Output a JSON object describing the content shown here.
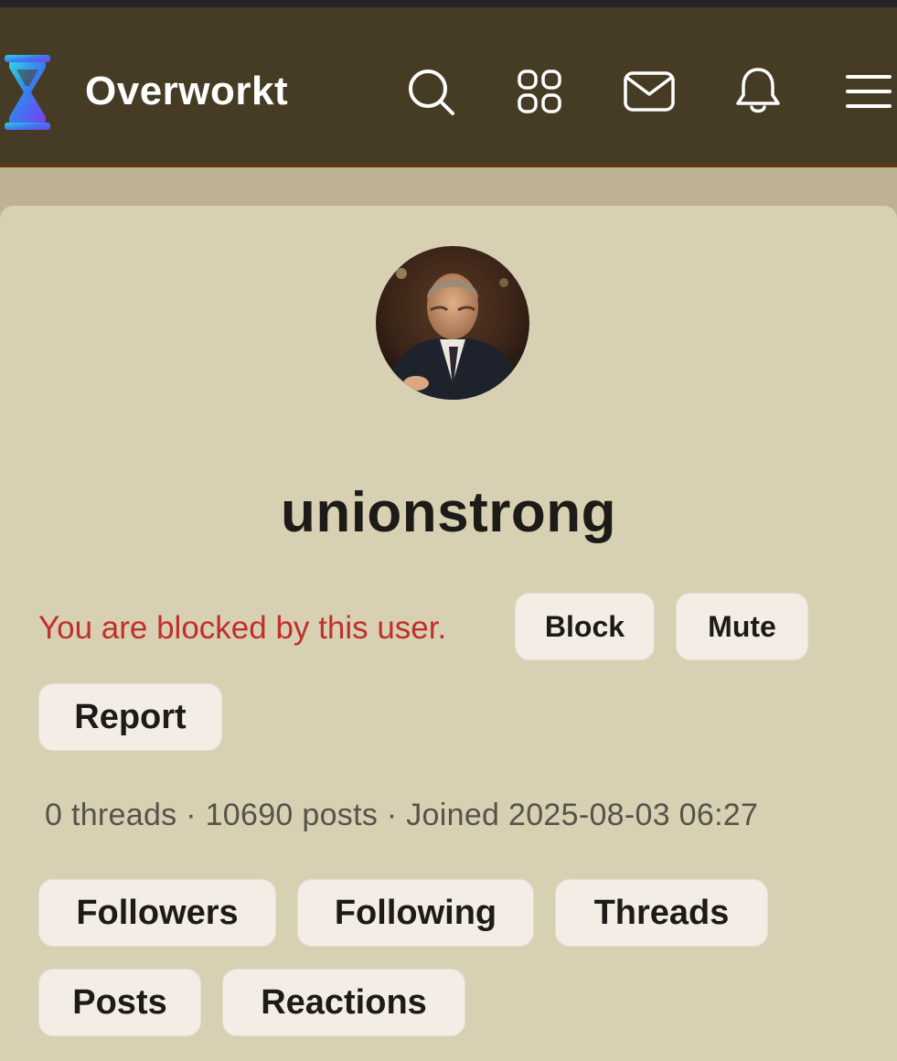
{
  "header": {
    "brand": "Overworkt",
    "logo_icon": "hourglass-logo",
    "nav_icons": [
      "search-icon",
      "grid-icon",
      "mail-icon",
      "bell-icon",
      "menu-icon"
    ]
  },
  "profile": {
    "username": "unionstrong",
    "blocked_notice": "You are blocked by this user.",
    "actions": {
      "block": "Block",
      "mute": "Mute",
      "report": "Report"
    },
    "stats": "0 threads · 10690 posts · Joined 2025-08-03 06:27",
    "tabs": {
      "followers": "Followers",
      "following": "Following",
      "threads": "Threads",
      "posts": "Posts",
      "reactions": "Reactions"
    }
  },
  "colors": {
    "header_bg": "#463b24",
    "page_bg": "#bdb293",
    "card_bg": "#d8d0b2",
    "pill_bg": "#f3ede6",
    "blocked_text": "#c0302a"
  }
}
